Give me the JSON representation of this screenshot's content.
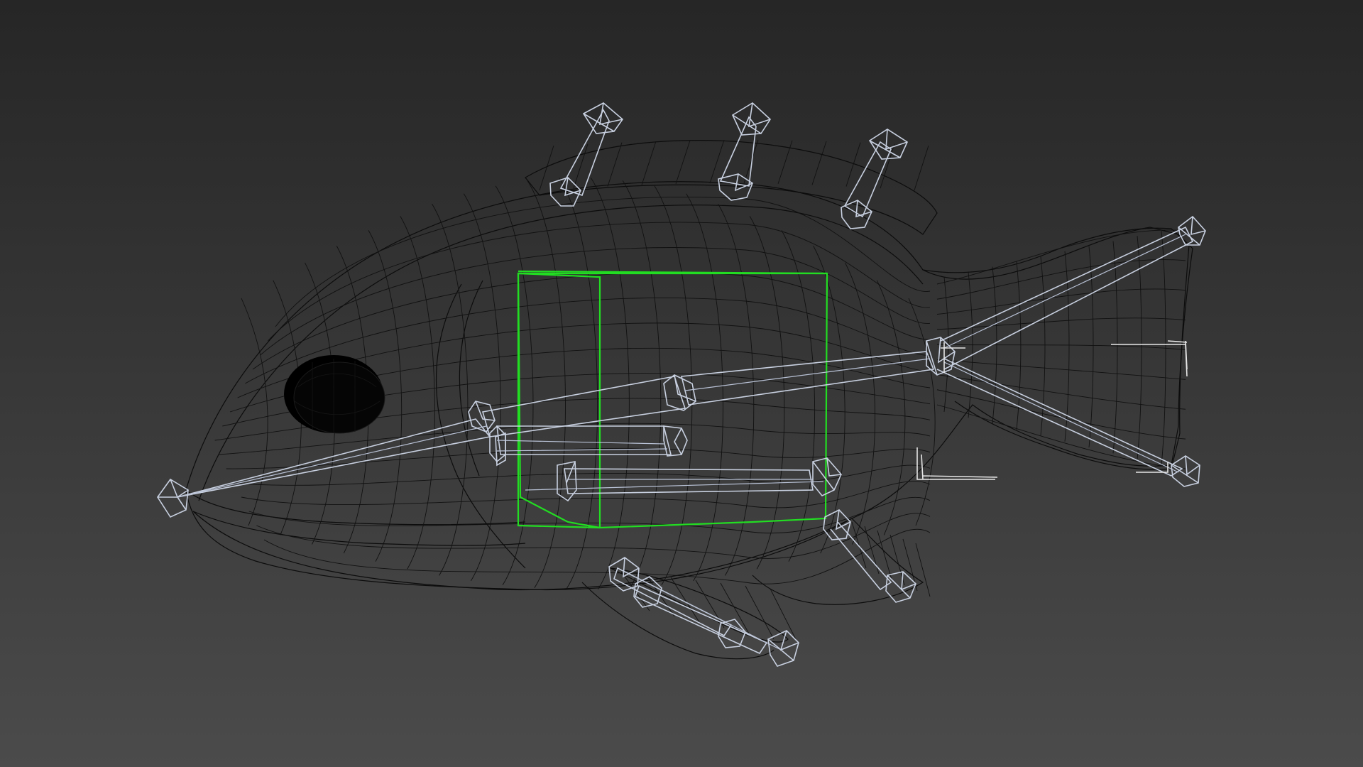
{
  "viewport": {
    "background_top": "#262626",
    "background_bottom": "#4b4b4b",
    "render_mode": "wireframe"
  },
  "object": {
    "type": "fish mesh",
    "wire_color": "#0c0c0c",
    "eye_color": "#000000"
  },
  "rig": {
    "bone_color": "#c8d0e0",
    "bone_count": 14
  },
  "selection": {
    "color": "#22dd22"
  }
}
